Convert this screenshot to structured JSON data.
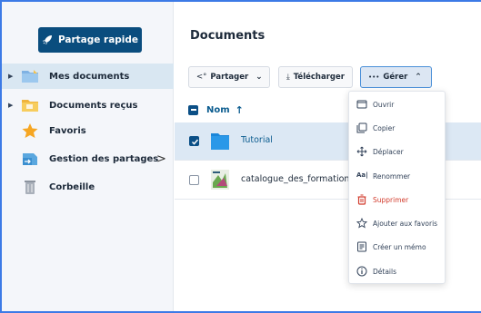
{
  "sidebar": {
    "quick_share_label": "Partage rapide",
    "items": [
      {
        "label": "Mes documents",
        "icon": "folder-blue-icon",
        "active": true
      },
      {
        "label": "Documents reçus",
        "icon": "folder-yellow-icon",
        "active": false
      },
      {
        "label": "Favoris",
        "icon": "star-icon",
        "active": false
      },
      {
        "label": "Gestion des partages",
        "icon": "share-folder-icon",
        "active": false
      },
      {
        "label": "Corbeille",
        "icon": "trash-icon",
        "active": false
      }
    ]
  },
  "main": {
    "title": "Documents",
    "toolbar": {
      "share_label": "Partager",
      "download_label": "Télécharger",
      "manage_label": "Gérer",
      "manage_prefix": "•••"
    },
    "column_header": "Nom",
    "rows": [
      {
        "name": "Tutorial",
        "selected": true,
        "type": "folder"
      },
      {
        "name": "catalogue_des_formations",
        "selected": false,
        "type": "file"
      }
    ]
  },
  "menu": {
    "items": [
      {
        "label": "Ouvrir",
        "icon": "open-icon"
      },
      {
        "label": "Copier",
        "icon": "copy-icon"
      },
      {
        "label": "Déplacer",
        "icon": "move-icon"
      },
      {
        "label": "Renommer",
        "icon": "rename-icon"
      },
      {
        "label": "Supprimer",
        "icon": "trash-icon",
        "danger": true
      },
      {
        "label": "Ajouter aux favoris",
        "icon": "star-outline-icon"
      },
      {
        "label": "Créer un mémo",
        "icon": "memo-icon"
      },
      {
        "label": "Détails",
        "icon": "info-icon"
      }
    ]
  },
  "colors": {
    "primary": "#0a4d7e",
    "accent": "#3c7ae6",
    "danger": "#d23b2c",
    "selected_row": "#dce8f4",
    "sidebar_bg": "#f4f6fa"
  }
}
